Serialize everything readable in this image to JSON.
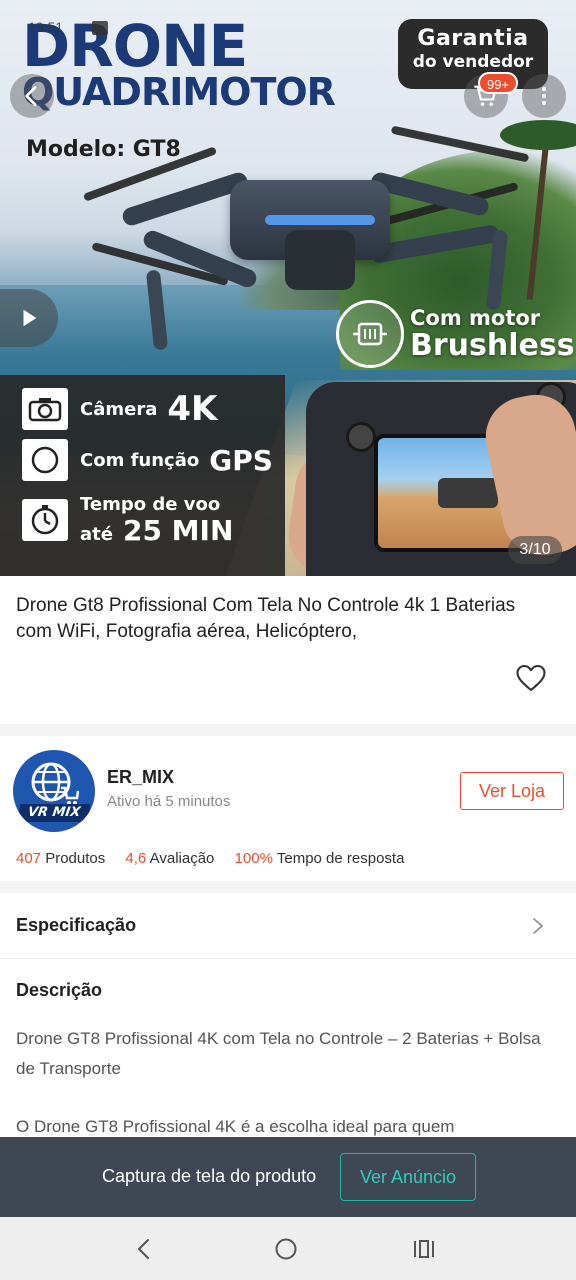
{
  "status": {
    "time": "19:51"
  },
  "hero": {
    "title_line1": "DRONE",
    "title_line2": "QUADRIMOTOR",
    "model": "Modelo: GT8",
    "warranty_line1": "Garantia",
    "warranty_line2": "do vendedor",
    "cart_badge": "99+",
    "features": [
      {
        "label": "Câmera",
        "value": "4K"
      },
      {
        "label": "Com função",
        "value": "GPS"
      },
      {
        "label": "Tempo de voo",
        "label2": "até",
        "value": "25 MIN"
      }
    ],
    "motor_line1": "Com motor",
    "motor_line2": "Brushless",
    "counter": "3/10",
    "icons": {
      "back": "back-arrow-icon",
      "cart": "cart-icon",
      "more": "more-vertical-icon",
      "play": "play-icon"
    }
  },
  "product": {
    "title": "Drone Gt8 Profissional Com Tela No Controle 4k 1 Baterias com WiFi, Fotografia aérea, Helicóptero,"
  },
  "shop": {
    "logo_text": "VR MIX",
    "name": "ER_MIX",
    "active": "Ativo há 5 minutos",
    "store_button": "Ver Loja",
    "stats": {
      "products_count": "407",
      "products_label": "Produtos",
      "rating": "4,6",
      "rating_label": "Avaliação",
      "response_rate": "100%",
      "response_label": "Tempo de resposta"
    }
  },
  "spec": {
    "label": "Especificação"
  },
  "description": {
    "heading": "Descrição",
    "paragraph1": "Drone GT8 Profissional 4K com Tela no Controle – 2 Baterias + Bolsa de Transporte",
    "paragraph2": "O Drone GT8 Profissional 4K é a escolha ideal para quem"
  },
  "capture_bar": {
    "label": "Captura de tela do produto",
    "button": "Ver Anúncio"
  },
  "colors": {
    "accent": "#ee4d2d",
    "teal": "#26b5a5",
    "bar": "#3e4753"
  }
}
